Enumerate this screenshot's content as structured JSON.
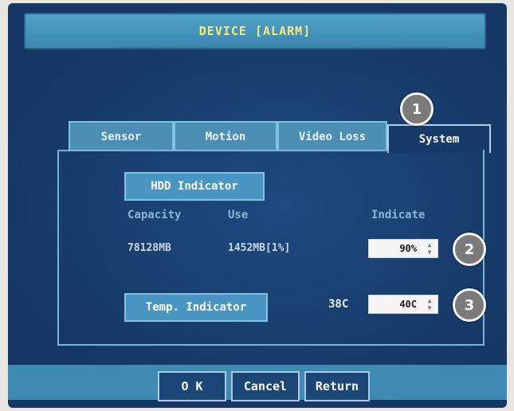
{
  "title": "DEVICE [ALARM]",
  "tabs": [
    {
      "label": "Sensor"
    },
    {
      "label": "Motion"
    },
    {
      "label": "Video Loss"
    },
    {
      "label": "System"
    }
  ],
  "active_tab": "System",
  "hdd": {
    "section_label": "HDD Indicator",
    "headers": {
      "capacity": "Capacity",
      "use": "Use",
      "indicate": "Indicate"
    },
    "capacity": "78128MB",
    "use": "1452MB[1%]",
    "indicate_value": "90%"
  },
  "temp": {
    "section_label": "Temp. Indicator",
    "current": "38C",
    "threshold_value": "40C"
  },
  "callouts": [
    "1",
    "2",
    "3"
  ],
  "buttons": {
    "ok": "O K",
    "cancel": "Cancel",
    "return": "Return"
  },
  "icons": {
    "spinner": "updown-arrow-icon"
  }
}
